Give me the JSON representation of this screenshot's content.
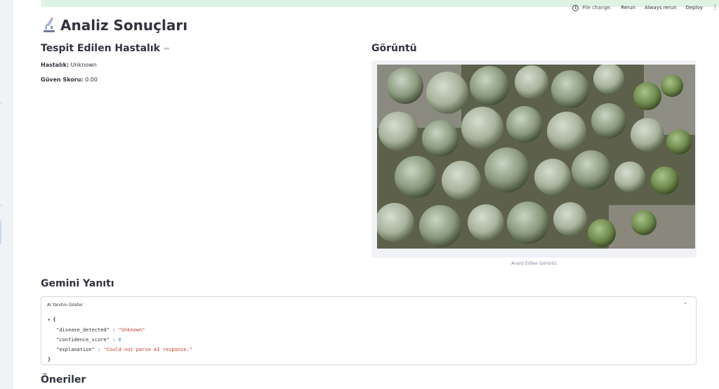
{
  "toolbar": {
    "status": "File change.",
    "rerun": "Rerun",
    "always_rerun": "Always rerun",
    "deploy": "Deploy",
    "menu_icon": "kebab-menu-icon"
  },
  "page": {
    "title": "Analiz Sonuçları",
    "title_icon": "microscope-icon"
  },
  "result": {
    "heading": "Tespit Edilen Hastalık",
    "link_icon": "link-icon",
    "disease_label": "Hastalık:",
    "disease_value": "Unknown",
    "confidence_label": "Güven Skoru:",
    "confidence_value": "0.00"
  },
  "image_section": {
    "heading": "Görüntü",
    "caption": "Analiz Edilen Görüntü"
  },
  "gemini": {
    "heading": "Gemini Yanıtı",
    "expander_label": "AI Yanıtını Göster",
    "json_open": "{",
    "json_close": "}",
    "fields": [
      {
        "key": "\"disease_detected\"",
        "value": "\"Unknown\"",
        "type": "str"
      },
      {
        "key": "\"confidence_score\"",
        "value": "0",
        "type": "num"
      },
      {
        "key": "\"explanation\"",
        "value": "\"Could not parse AI response.\"",
        "type": "str"
      }
    ]
  },
  "recommendations": {
    "heading": "Öneriler"
  }
}
